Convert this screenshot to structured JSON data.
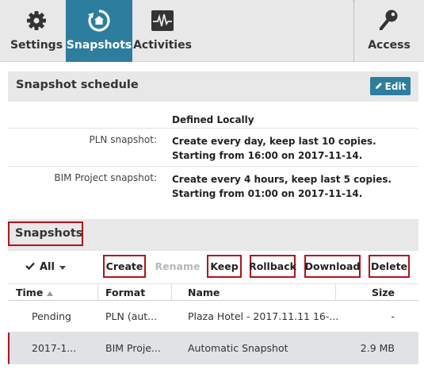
{
  "toolbar": {
    "items": [
      {
        "label": "Settings",
        "icon": "gear-icon"
      },
      {
        "label": "Snapshots",
        "icon": "snapshot-restore-icon",
        "active": true
      },
      {
        "label": "Activities",
        "icon": "activity-pulse-icon"
      },
      {
        "label": "Access",
        "icon": "key-icon"
      }
    ]
  },
  "schedule": {
    "title": "Snapshot schedule",
    "edit_label": "Edit",
    "defined": "Defined Locally",
    "rows": [
      {
        "label": "PLN snapshot:",
        "line1": "Create every day, keep last 10 copies.",
        "line2": "Starting from 16:00 on 2017-11-14."
      },
      {
        "label": "BIM Project snapshot:",
        "line1": "Create every 4 hours, keep last 5 copies.",
        "line2": "Starting from 01:00 on 2017-11-14."
      }
    ]
  },
  "snapshots": {
    "title": "Snapshots",
    "select_all": "All",
    "actions": {
      "create": "Create",
      "rename": "Rename",
      "keep": "Keep",
      "rollback": "Rollback",
      "download": "Download",
      "delete": "Delete"
    },
    "columns": {
      "time": "Time",
      "format": "Format",
      "name": "Name",
      "size": "Size"
    },
    "rows": [
      {
        "time": "Pending",
        "format": "PLN (aut...",
        "name": "Plaza Hotel - 2017.11.11 16-...",
        "size": "-"
      },
      {
        "time": "2017-1...",
        "format": "BIM Proje...",
        "name": "Automatic Snapshot",
        "size": "2.9 MB",
        "selected": true
      }
    ]
  },
  "colors": {
    "accent": "#2d7d9f",
    "highlight": "#b5121b",
    "toolbar_bg": "#e8e8e8"
  }
}
